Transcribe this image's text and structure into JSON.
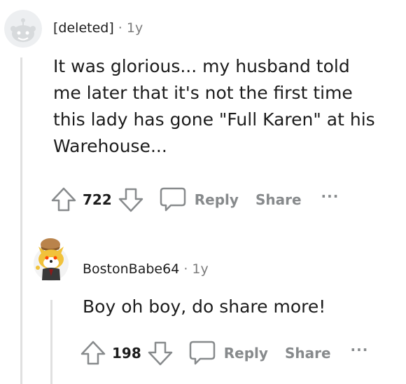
{
  "comments": [
    {
      "author": "[deleted]",
      "separator": "·",
      "age": "1y",
      "body_lines": [
        "It was glorious... my husband told",
        "me later that it's not the first time",
        "this lady has gone \"Full Karen\" at his",
        "Warehouse..."
      ],
      "score": "722",
      "reply_label": "Reply",
      "share_label": "Share",
      "more_label": "···"
    },
    {
      "author": "BostonBabe64",
      "separator": "·",
      "age": "1y",
      "body_lines": [
        "Boy oh boy, do share more!"
      ],
      "score": "198",
      "reply_label": "Reply",
      "share_label": "Share",
      "more_label": "···"
    }
  ],
  "icons": {
    "upvote": "upvote-arrow-icon",
    "downvote": "downvote-arrow-icon",
    "reply": "speech-bubble-icon",
    "deleted_avatar": "snoo-default-avatar-icon",
    "user_avatar": "snoo-shiba-avatar-icon"
  },
  "colors": {
    "text": "#1c1c1c",
    "muted": "#878a8c",
    "thread_line": "#e0e0e0",
    "avatar_placeholder": "#d7dadc"
  }
}
